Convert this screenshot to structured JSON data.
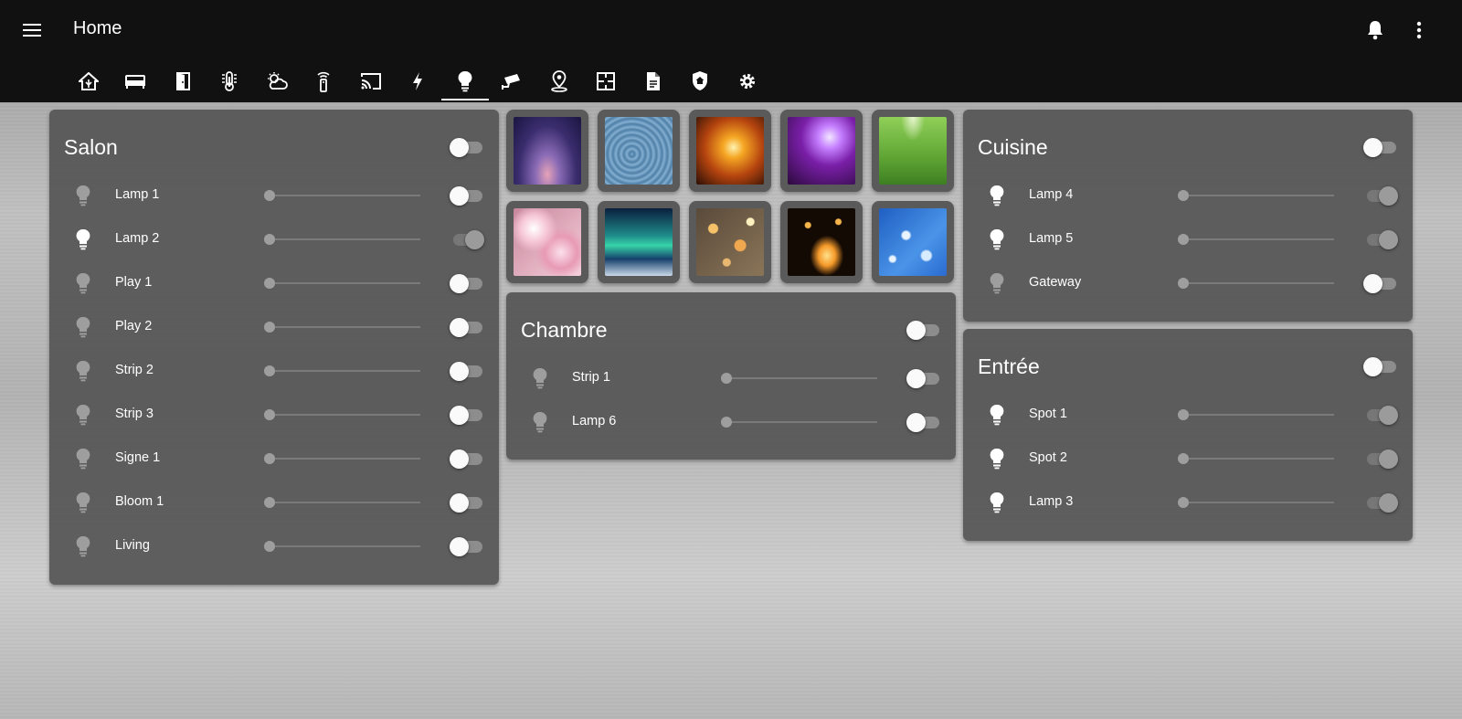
{
  "header": {
    "title": "Home",
    "menu_icon": "hamburger-menu-icon",
    "actions": [
      {
        "name": "notifications-icon"
      },
      {
        "name": "more-vertical-icon"
      }
    ]
  },
  "tabs": [
    {
      "name": "tab-home",
      "icon": "home-icon"
    },
    {
      "name": "tab-living",
      "icon": "sofa-icon"
    },
    {
      "name": "tab-doors",
      "icon": "door-icon"
    },
    {
      "name": "tab-climate",
      "icon": "thermometer-icon"
    },
    {
      "name": "tab-weather",
      "icon": "weather-icon"
    },
    {
      "name": "tab-remote",
      "icon": "remote-icon"
    },
    {
      "name": "tab-cast",
      "icon": "cast-icon"
    },
    {
      "name": "tab-energy",
      "icon": "lightning-icon"
    },
    {
      "name": "tab-lights",
      "icon": "lightbulb-icon",
      "active": true
    },
    {
      "name": "tab-cameras",
      "icon": "cctv-icon"
    },
    {
      "name": "tab-location",
      "icon": "map-marker-icon"
    },
    {
      "name": "tab-floorplan",
      "icon": "floor-plan-icon"
    },
    {
      "name": "tab-logbook",
      "icon": "document-icon"
    },
    {
      "name": "tab-security",
      "icon": "shield-home-icon"
    },
    {
      "name": "tab-settings",
      "icon": "gear-icon"
    }
  ],
  "colors": {
    "topbar": "#111111",
    "card": "#555555",
    "bulb_on": "#ffffff",
    "bulb_off": "#9e9e9e"
  },
  "cards": {
    "salon": {
      "title": "Salon",
      "all_on": false,
      "lights": [
        {
          "name": "Lamp 1",
          "on": false
        },
        {
          "name": "Lamp 2",
          "on": true
        },
        {
          "name": "Play 1",
          "on": false
        },
        {
          "name": "Play 2",
          "on": false
        },
        {
          "name": "Strip 2",
          "on": false
        },
        {
          "name": "Strip 3",
          "on": false
        },
        {
          "name": "Signe 1",
          "on": false
        },
        {
          "name": "Bloom 1",
          "on": false
        },
        {
          "name": "Living",
          "on": false
        }
      ]
    },
    "chambre": {
      "title": "Chambre",
      "all_on": false,
      "lights": [
        {
          "name": "Strip 1",
          "on": false
        },
        {
          "name": "Lamp 6",
          "on": false
        }
      ]
    },
    "cuisine": {
      "title": "Cuisine",
      "all_on": false,
      "lights": [
        {
          "name": "Lamp 4",
          "on": true
        },
        {
          "name": "Lamp 5",
          "on": true
        },
        {
          "name": "Gateway",
          "on": false
        }
      ]
    },
    "entree": {
      "title": "Entrée",
      "all_on": false,
      "lights": [
        {
          "name": "Spot 1",
          "on": true
        },
        {
          "name": "Spot 2",
          "on": true
        },
        {
          "name": "Lamp 3",
          "on": true
        }
      ]
    }
  },
  "scenes": [
    {
      "name": "scene-tropical-sunset"
    },
    {
      "name": "scene-blue-sand"
    },
    {
      "name": "scene-golden-grass"
    },
    {
      "name": "scene-disco-ball"
    },
    {
      "name": "scene-football-field"
    },
    {
      "name": "scene-cherry-blossom"
    },
    {
      "name": "scene-aurora"
    },
    {
      "name": "scene-bokeh-lights"
    },
    {
      "name": "scene-candles"
    },
    {
      "name": "scene-snowflakes"
    }
  ]
}
